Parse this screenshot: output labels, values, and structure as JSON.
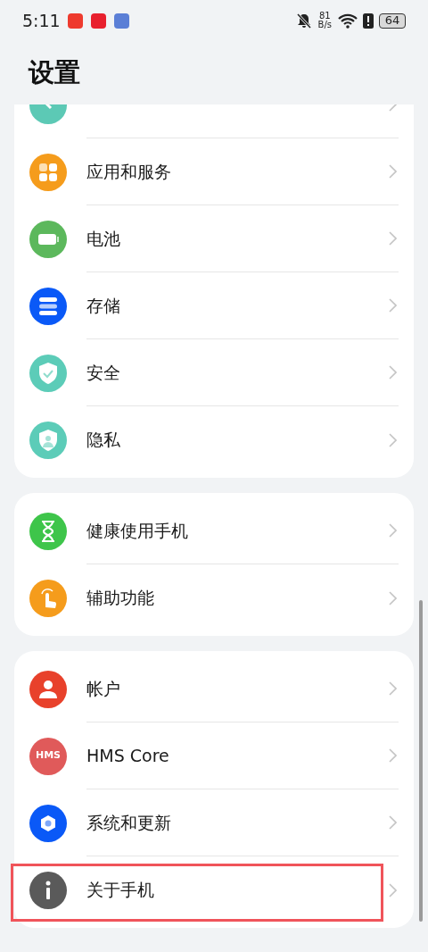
{
  "status_bar": {
    "time": "5:11",
    "net_speed_value": "81",
    "net_speed_unit": "B/s",
    "battery": "64"
  },
  "title": "设置",
  "groups": [
    {
      "items": [
        {
          "kind": "biometric",
          "highlighted": false
        },
        {
          "label": "应用和服务",
          "kind": "apps",
          "highlighted": false
        },
        {
          "label": "电池",
          "kind": "battery",
          "highlighted": false
        },
        {
          "label": "存储",
          "kind": "storage",
          "highlighted": false
        },
        {
          "label": "安全",
          "kind": "security",
          "highlighted": false
        },
        {
          "label": "隐私",
          "kind": "privacy",
          "highlighted": false
        }
      ]
    },
    {
      "items": [
        {
          "label": "健康使用手机",
          "kind": "health",
          "highlighted": false
        },
        {
          "label": "辅助功能",
          "kind": "accessibility",
          "highlighted": false
        }
      ]
    },
    {
      "items": [
        {
          "label": "帐户",
          "kind": "account",
          "highlighted": false
        },
        {
          "label": "HMS Core",
          "kind": "hms",
          "icon_text": "HMS",
          "highlighted": false
        },
        {
          "label": "系统和更新",
          "kind": "system",
          "highlighted": false
        },
        {
          "label": "关于手机",
          "kind": "about",
          "highlighted": true
        }
      ]
    }
  ]
}
